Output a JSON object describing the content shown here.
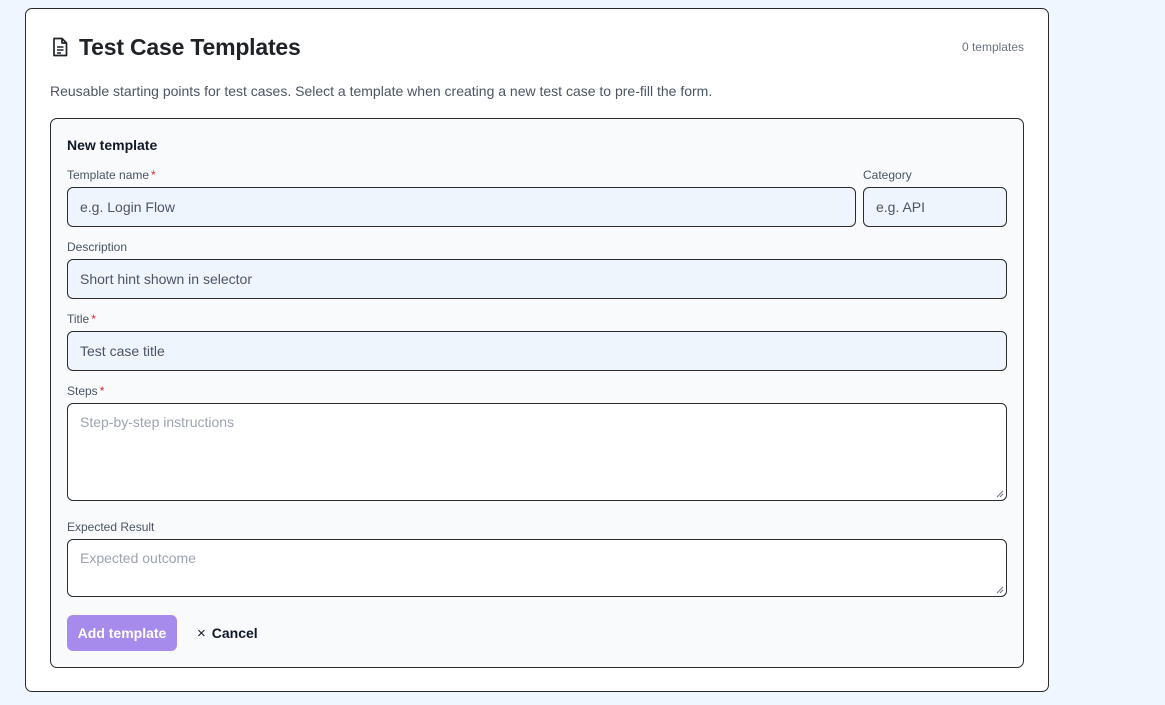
{
  "header": {
    "title": "Test Case Templates",
    "count": "0 templates",
    "subtitle": "Reusable starting points for test cases. Select a template when creating a new test case to pre-fill the form."
  },
  "form": {
    "heading": "New template",
    "required_marker": "*",
    "template_name": {
      "label": "Template name",
      "placeholder": "e.g. Login Flow"
    },
    "category": {
      "label": "Category",
      "placeholder": "e.g. API"
    },
    "description": {
      "label": "Description",
      "placeholder": "Short hint shown in selector"
    },
    "title": {
      "label": "Title",
      "placeholder": "Test case title"
    },
    "steps": {
      "label": "Steps",
      "placeholder": "Step-by-step instructions"
    },
    "expected_result": {
      "label": "Expected Result",
      "placeholder": "Expected outcome"
    },
    "add_button": "Add template",
    "cancel_icon": "×",
    "cancel_button": "Cancel"
  },
  "icons": {
    "header": "document-icon",
    "cancel": "close-icon"
  },
  "colors": {
    "page_bg": "#eff6ff",
    "accent_button": "#a78bec",
    "required": "#dc2626",
    "input_bg": "#eef5fd"
  }
}
